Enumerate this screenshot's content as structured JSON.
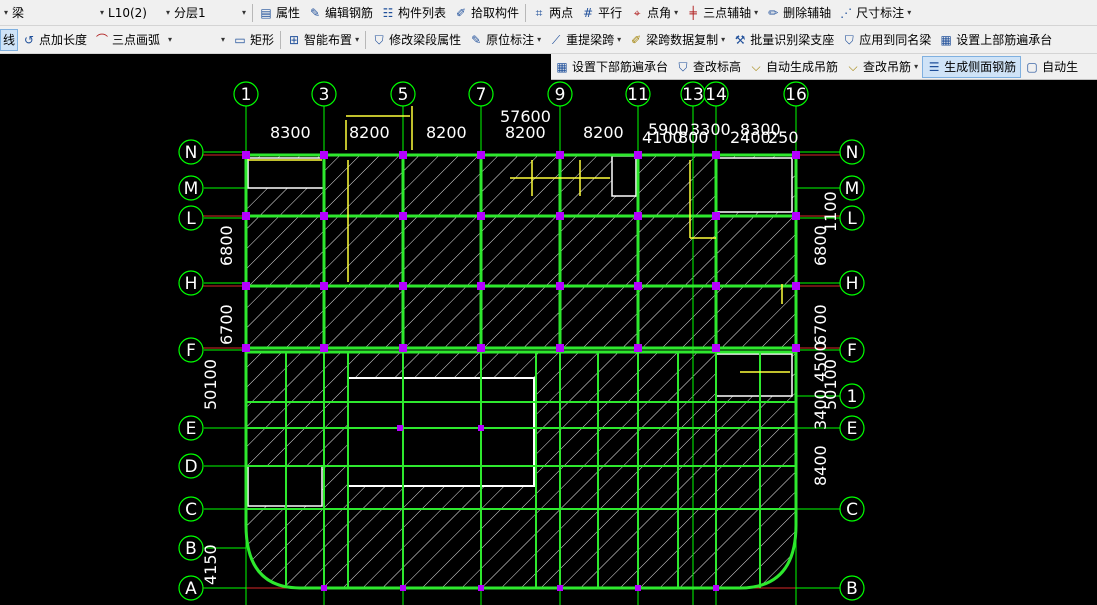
{
  "toolbar1": {
    "type_select": "梁",
    "item_select": "L10(2)",
    "layer_select": "分层1",
    "btn_property": "属性",
    "btn_edit_rebar": "编辑钢筋",
    "btn_component_list": "构件列表",
    "btn_pick": "拾取构件",
    "btn_two_points": "两点",
    "btn_parallel": "平行",
    "btn_point_angle": "点角",
    "btn_three_point_axis": "三点辅轴",
    "btn_delete_axis": "删除辅轴",
    "btn_dimension": "尺寸标注"
  },
  "toolbar2": {
    "btn_line": "线",
    "btn_point_length": "点加长度",
    "btn_three_point_arc": "三点画弧",
    "btn_rect": "矩形",
    "btn_smart_layout": "智能布置",
    "btn_modify_segment": "修改梁段属性",
    "btn_original_mark": "原位标注",
    "btn_re_span": "重提梁跨",
    "btn_copy_span": "梁跨数据复制",
    "btn_batch_support": "批量识别梁支座",
    "btn_apply_same": "应用到同名梁",
    "btn_set_top_rebar": "设置上部筋遍承台"
  },
  "toolbar3": {
    "btn_set_bottom_rebar": "设置下部筋遍承台",
    "btn_edit_height": "查改标高",
    "btn_auto_hanger": "自动生成吊筋",
    "btn_edit_hanger": "查改吊筋",
    "btn_side_rebar": "生成侧面钢筋",
    "btn_auto_gen": "自动生"
  },
  "drawing": {
    "axes_top": [
      "1",
      "3",
      "5",
      "7",
      "9",
      "11",
      "13",
      "14",
      "16"
    ],
    "axes_left": [
      "N",
      "M",
      "L",
      "H",
      "F",
      "E",
      "D",
      "C",
      "B",
      "A"
    ],
    "axes_right": [
      "N",
      "M",
      "L",
      "H",
      "F",
      "1",
      "E",
      "C",
      "B"
    ],
    "total_width_label": "57600",
    "spacing_labels": [
      "8300",
      "8200",
      "8200",
      "8200",
      "8200"
    ],
    "right_overlap_labels": [
      "5900",
      "3300",
      "4100",
      "800",
      "8300",
      "2400",
      "250"
    ],
    "left_dim_labels": [
      "6800",
      "6700",
      "50100",
      "4150"
    ],
    "right_dim_labels": [
      "6800",
      "6700",
      "50100",
      "3400",
      "4500",
      "8400",
      "1100"
    ],
    "colors": {
      "background": "#000000",
      "axis": "#00ff00",
      "beam_green": "#2ee82e",
      "beam_yellow": "#ffff3a",
      "hatch": "#ffffff",
      "column": "#b400ff",
      "dim_text": "#ffffff",
      "red_line": "#ff3030"
    }
  }
}
